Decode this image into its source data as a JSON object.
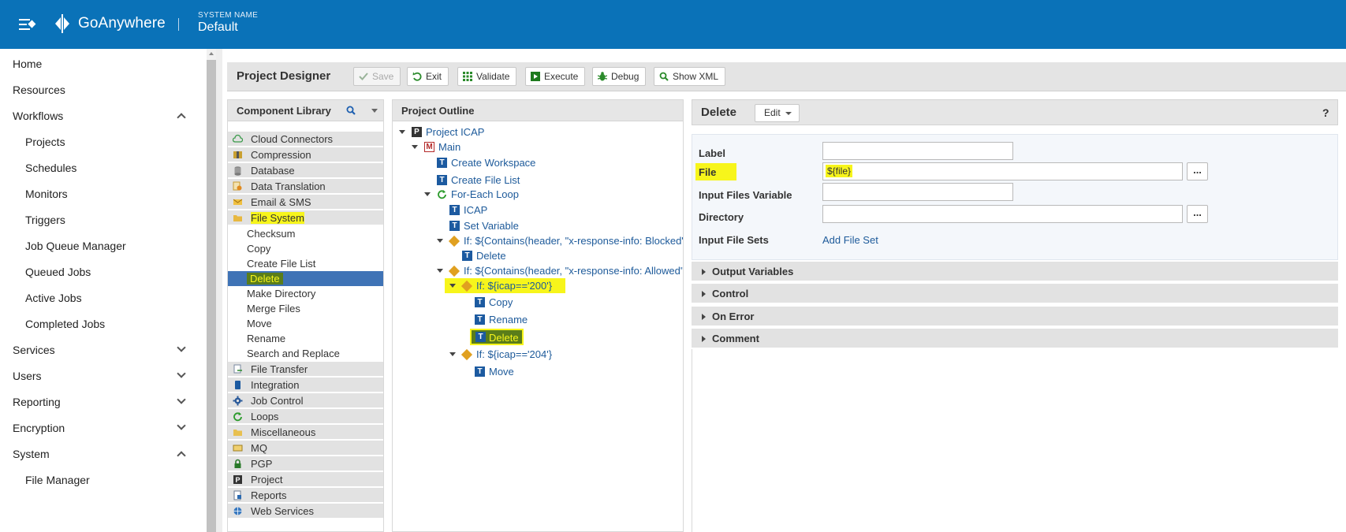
{
  "header": {
    "brand": "GoAnywhere",
    "system_name_label": "SYSTEM NAME",
    "system_name_value": "Default"
  },
  "nav": {
    "items": [
      {
        "label": "Home",
        "level": "top"
      },
      {
        "label": "Resources",
        "level": "top"
      },
      {
        "label": "Workflows",
        "level": "top",
        "chevron": "up"
      },
      {
        "label": "Projects",
        "level": "sub"
      },
      {
        "label": "Schedules",
        "level": "sub"
      },
      {
        "label": "Monitors",
        "level": "sub"
      },
      {
        "label": "Triggers",
        "level": "sub"
      },
      {
        "label": "Job Queue Manager",
        "level": "sub"
      },
      {
        "label": "Queued Jobs",
        "level": "sub"
      },
      {
        "label": "Active Jobs",
        "level": "sub"
      },
      {
        "label": "Completed Jobs",
        "level": "sub"
      },
      {
        "label": "Services",
        "level": "top",
        "chevron": "down"
      },
      {
        "label": "Users",
        "level": "top",
        "chevron": "down"
      },
      {
        "label": "Reporting",
        "level": "top",
        "chevron": "down"
      },
      {
        "label": "Encryption",
        "level": "top",
        "chevron": "down"
      },
      {
        "label": "System",
        "level": "top",
        "chevron": "up"
      },
      {
        "label": "File Manager",
        "level": "sub"
      }
    ]
  },
  "toolbar": {
    "title": "Project Designer",
    "save": "Save",
    "exit": "Exit",
    "validate": "Validate",
    "execute": "Execute",
    "debug": "Debug",
    "show_xml": "Show XML"
  },
  "library": {
    "title": "Component Library",
    "categories_top": [
      "Cloud Connectors",
      "Compression",
      "Database",
      "Data Translation",
      "Email & SMS",
      "File System"
    ],
    "file_system_items": [
      "Checksum",
      "Copy",
      "Create File List",
      "Delete",
      "Make Directory",
      "Merge Files",
      "Move",
      "Rename",
      "Search and Replace"
    ],
    "selected_item": "Delete",
    "categories_bottom": [
      "File Transfer",
      "Integration",
      "Job Control",
      "Loops",
      "Miscellaneous",
      "MQ",
      "PGP",
      "Project",
      "Reports",
      "Web Services"
    ]
  },
  "outline": {
    "title": "Project Outline",
    "nodes": [
      {
        "label": "Project ICAP",
        "icon": "P"
      },
      {
        "label": "Main",
        "icon": "M"
      },
      {
        "label": "Create Workspace",
        "icon": "T"
      },
      {
        "label": "Create File List",
        "icon": "T"
      },
      {
        "label": "For-Each Loop",
        "icon": "loop"
      },
      {
        "label": "ICAP",
        "icon": "T"
      },
      {
        "label": "Set Variable",
        "icon": "T"
      },
      {
        "label": "If: ${Contains(header, \"x-response-info: Blocked\")}",
        "icon": "if"
      },
      {
        "label": "Delete",
        "icon": "T"
      },
      {
        "label": "If: ${Contains(header, \"x-response-info: Allowed\")}",
        "icon": "if"
      },
      {
        "label": "If: ${icap=='200'}",
        "icon": "if"
      },
      {
        "label": "Copy",
        "icon": "T"
      },
      {
        "label": "Rename",
        "icon": "T"
      },
      {
        "label": "Delete",
        "icon": "T"
      },
      {
        "label": "If: ${icap=='204'}",
        "icon": "if"
      },
      {
        "label": "Move",
        "icon": "T"
      }
    ]
  },
  "detail": {
    "title": "Delete",
    "edit": "Edit",
    "help": "?",
    "fields": {
      "label_label": "Label",
      "label_value": "",
      "file_label": "File",
      "file_value": "${file}",
      "input_files_variable_label": "Input Files Variable",
      "input_files_variable_value": "",
      "directory_label": "Directory",
      "directory_value": "",
      "input_file_sets_label": "Input File Sets",
      "add_file_set": "Add File Set",
      "browse": "..."
    },
    "sections": [
      "Output Variables",
      "Control",
      "On Error",
      "Comment"
    ]
  },
  "colors": {
    "topbar": "#0a72b8",
    "selected": "#3f73b6",
    "highlight": "#f7f51b",
    "link": "#1d5a9a"
  }
}
